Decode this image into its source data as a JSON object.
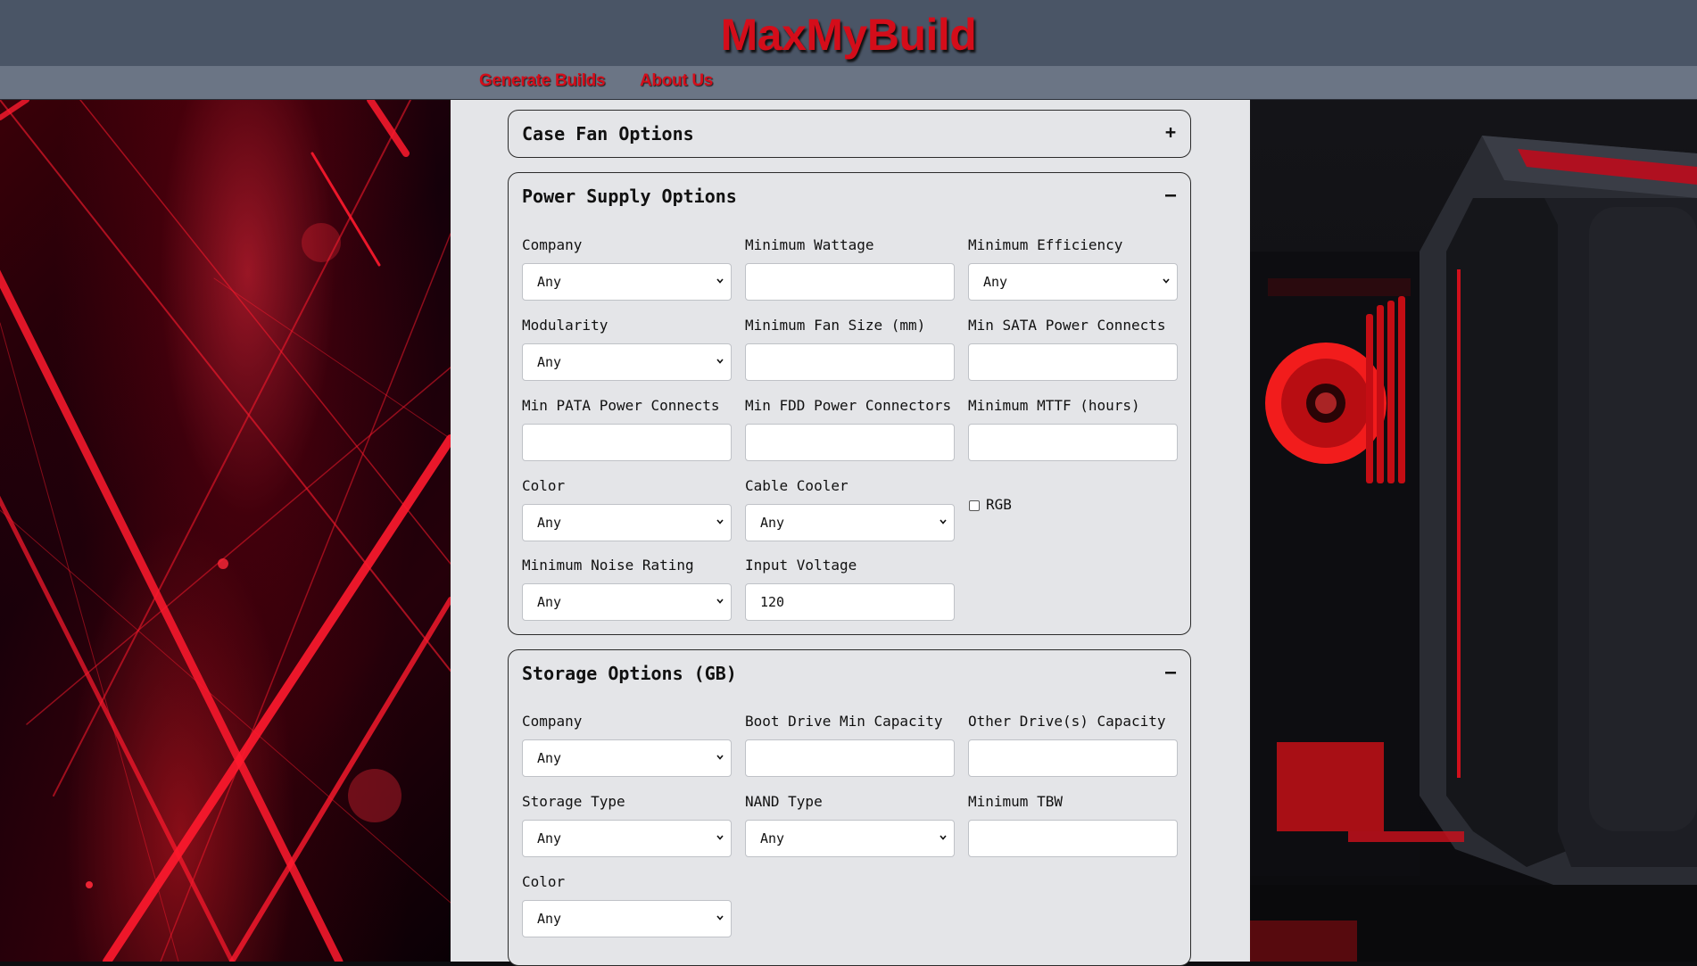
{
  "header": {
    "title": "MaxMyBuild"
  },
  "nav": {
    "items": [
      "Generate Builds",
      "About Us"
    ]
  },
  "colors": {
    "brand_red": "#d40d1a",
    "header_bg": "#4a5566",
    "nav_bg": "#6b7585",
    "panel_bg": "#e4e5e8"
  },
  "panels": {
    "case_fan": {
      "title": "Case Fan Options",
      "toggle": "+"
    },
    "power_supply": {
      "title": "Power Supply Options",
      "toggle": "–",
      "fields": [
        {
          "label": "Company",
          "type": "select",
          "value": "Any"
        },
        {
          "label": "Minimum Wattage",
          "type": "input",
          "value": ""
        },
        {
          "label": "Minimum Efficiency",
          "type": "select",
          "value": "Any"
        },
        {
          "label": "Modularity",
          "type": "select",
          "value": "Any"
        },
        {
          "label": "Minimum Fan Size (mm)",
          "type": "input",
          "value": ""
        },
        {
          "label": "Min SATA Power Connects",
          "type": "input",
          "value": ""
        },
        {
          "label": "Min PATA Power Connects",
          "type": "input",
          "value": ""
        },
        {
          "label": "Min FDD Power Connectors",
          "type": "input",
          "value": ""
        },
        {
          "label": "Minimum MTTF (hours)",
          "type": "input",
          "value": ""
        },
        {
          "label": "Color",
          "type": "select",
          "value": "Any"
        },
        {
          "label": "Cable Cooler",
          "type": "select",
          "value": "Any"
        },
        {
          "label": "RGB",
          "type": "checkbox",
          "value": ""
        },
        {
          "label": "Minimum Noise Rating",
          "type": "select",
          "value": "Any"
        },
        {
          "label": "Input Voltage",
          "type": "input",
          "value": "120"
        }
      ]
    },
    "storage": {
      "title": "Storage Options (GB)",
      "toggle": "–",
      "fields": [
        {
          "label": "Company",
          "type": "select",
          "value": "Any"
        },
        {
          "label": "Boot Drive Min Capacity",
          "type": "input",
          "value": ""
        },
        {
          "label": "Other Drive(s) Capacity",
          "type": "input",
          "value": ""
        },
        {
          "label": "Storage Type",
          "type": "select",
          "value": "Any"
        },
        {
          "label": "NAND Type",
          "type": "select",
          "value": "Any"
        },
        {
          "label": "Minimum TBW",
          "type": "input",
          "value": ""
        },
        {
          "label": "Color",
          "type": "select",
          "value": "Any"
        }
      ]
    }
  }
}
